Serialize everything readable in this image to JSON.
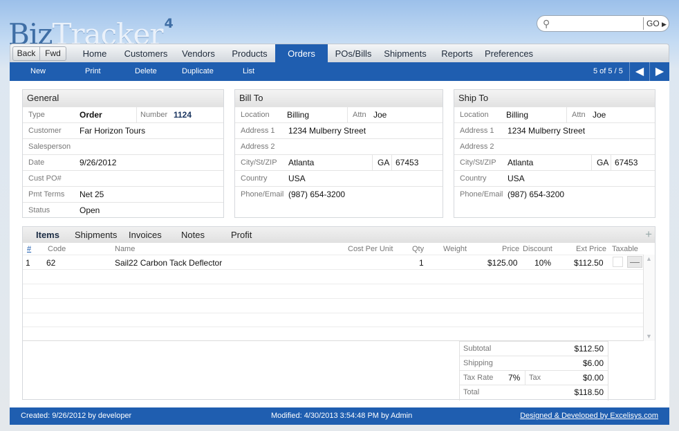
{
  "app": {
    "name_part1": "Biz",
    "name_part2": "Tracker",
    "version": "4"
  },
  "search": {
    "placeholder": "",
    "go_label": "GO"
  },
  "history": {
    "back": "Back",
    "fwd": "Fwd"
  },
  "nav": {
    "home": "Home",
    "customers": "Customers",
    "vendors": "Vendors",
    "products": "Products",
    "orders": "Orders",
    "pos_bills": "POs/Bills",
    "shipments": "Shipments",
    "reports": "Reports",
    "preferences": "Preferences",
    "active": "Orders"
  },
  "actions": {
    "new": "New",
    "print": "Print",
    "delete": "Delete",
    "duplicate": "Duplicate",
    "list": "List"
  },
  "pager": {
    "text": "5 of 5 / 5"
  },
  "general": {
    "title": "General",
    "type_label": "Type",
    "type": "Order",
    "number_label": "Number",
    "number": "1124",
    "customer_label": "Customer",
    "customer": "Far Horizon Tours",
    "salesperson_label": "Salesperson",
    "salesperson": "",
    "date_label": "Date",
    "date": "9/26/2012",
    "cust_po_label": "Cust PO#",
    "cust_po": "",
    "pmt_terms_label": "Pmt Terms",
    "pmt_terms": "Net 25",
    "status_label": "Status",
    "status": "Open"
  },
  "bill_to": {
    "title": "Bill To",
    "location_label": "Location",
    "location": "Billing",
    "attn_label": "Attn",
    "attn": "Joe",
    "address1_label": "Address 1",
    "address1": "1234 Mulberry Street",
    "address2_label": "Address 2",
    "address2": "",
    "city_label": "City/St/ZIP",
    "city": "Atlanta",
    "state": "GA",
    "zip": "67453",
    "country_label": "Country",
    "country": "USA",
    "phone_label": "Phone/Email",
    "phone": "(987) 654-3200"
  },
  "ship_to": {
    "title": "Ship To",
    "location_label": "Location",
    "location": "Billing",
    "attn_label": "Attn",
    "attn": "Joe",
    "address1_label": "Address 1",
    "address1": "1234 Mulberry Street",
    "address2_label": "Address 2",
    "address2": "",
    "city_label": "City/St/ZIP",
    "city": "Atlanta",
    "state": "GA",
    "zip": "67453",
    "country_label": "Country",
    "country": "USA",
    "phone_label": "Phone/Email",
    "phone": "(987) 654-3200"
  },
  "item_tabs": {
    "items": "Items",
    "shipments": "Shipments",
    "invoices": "Invoices",
    "notes": "Notes",
    "profit": "Profit"
  },
  "columns": {
    "num": "#",
    "code": "Code",
    "name": "Name",
    "cost": "Cost Per Unit",
    "qty": "Qty",
    "weight": "Weight",
    "price": "Price",
    "discount": "Discount",
    "ext_price": "Ext Price",
    "taxable": "Taxable"
  },
  "line_items": [
    {
      "num": "1",
      "code": "62",
      "name": "Sail22 Carbon Tack Deflector",
      "cost": "",
      "qty": "1",
      "weight": "",
      "price": "$125.00",
      "discount": "10%",
      "ext_price": "$112.50"
    }
  ],
  "totals": {
    "subtotal_label": "Subtotal",
    "subtotal": "$112.50",
    "shipping_label": "Shipping",
    "shipping": "$6.00",
    "tax_rate_label": "Tax Rate",
    "tax_rate": "7%",
    "tax_label": "Tax",
    "tax": "$0.00",
    "total_label": "Total",
    "total": "$118.50"
  },
  "footer": {
    "created": "Created: 9/26/2012 by developer",
    "modified": "Modified: 4/30/2013 3:54:48 PM by Admin",
    "credit": "Designed & Developed by Excelisys.com"
  },
  "colors": {
    "accent": "#1f5eb0",
    "logo_blue": "#3f6ea5"
  }
}
